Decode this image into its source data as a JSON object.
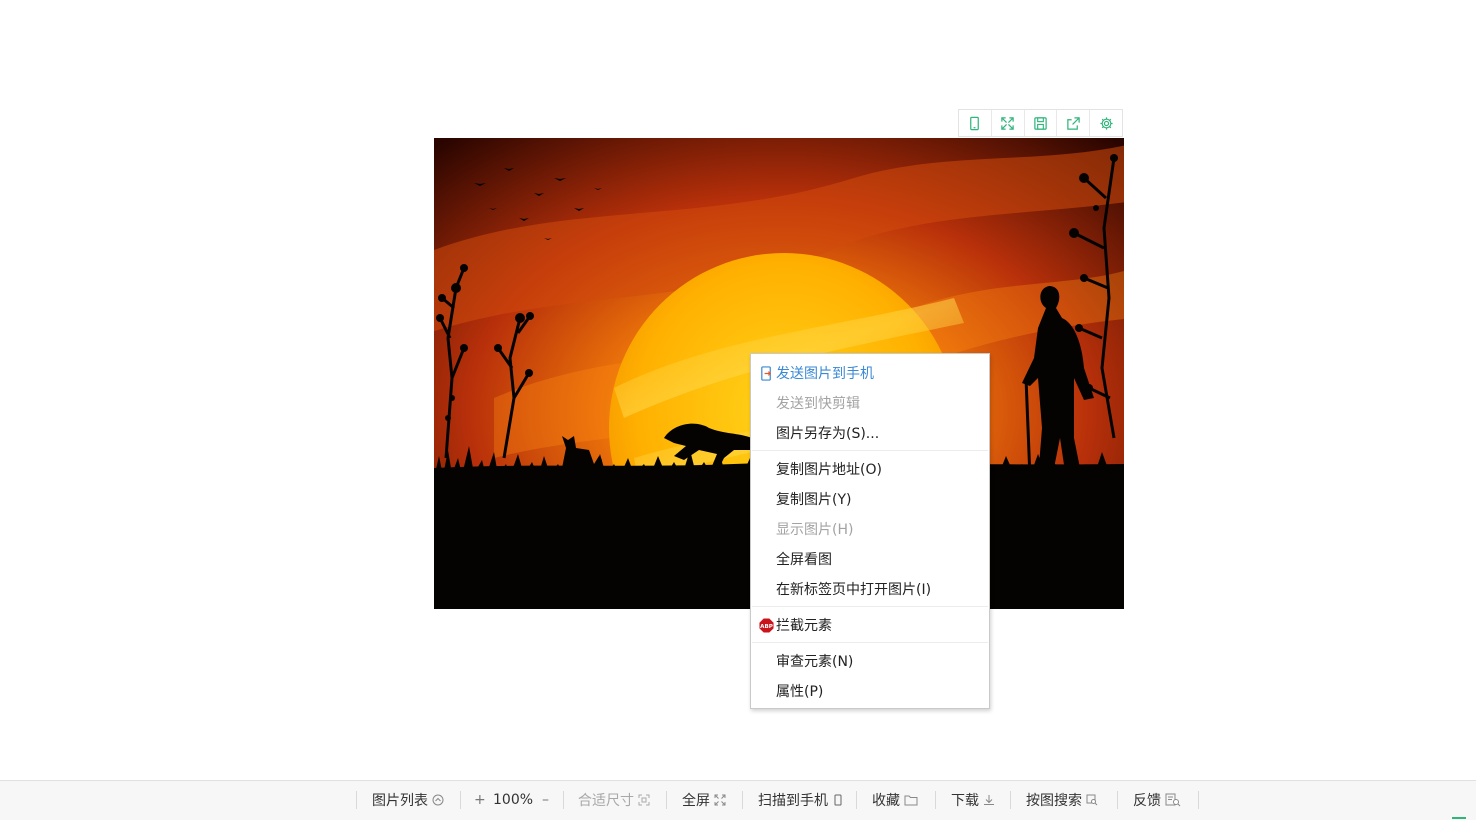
{
  "toolbar": {
    "buttons": [
      {
        "icon": "phone-icon"
      },
      {
        "icon": "expand-icon"
      },
      {
        "icon": "save-icon"
      },
      {
        "icon": "share-icon"
      },
      {
        "icon": "gear-icon"
      }
    ],
    "accent_color": "#2fb47a"
  },
  "context_menu": {
    "send_to_phone": "发送图片到手机",
    "send_to_clipboard": "发送到快剪辑",
    "save_as": "图片另存为(S)...",
    "copy_address": "复制图片地址(O)",
    "copy_image": "复制图片(Y)",
    "show_image": "显示图片(H)",
    "fullscreen_view": "全屏看图",
    "open_new_tab": "在新标签页中打开图片(I)",
    "block_element": "拦截元素",
    "inspect": "审查元素(N)",
    "properties": "属性(P)",
    "abp_icon_text": "ABP"
  },
  "bottom_bar": {
    "image_list": "图片列表",
    "zoom_in": "+",
    "zoom_level": "100%",
    "zoom_out": "–",
    "fit_size": "合适尺寸",
    "fullscreen": "全屏",
    "scan_to_phone": "扫描到手机",
    "favorite": "收藏",
    "download": "下载",
    "search_by_image": "按图搜索",
    "feedback": "反馈"
  }
}
